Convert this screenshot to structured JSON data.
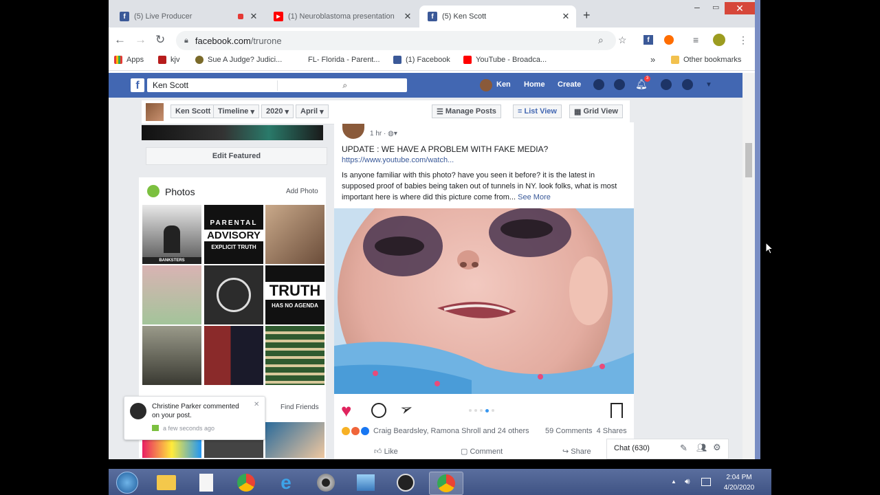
{
  "browser": {
    "tabs": [
      {
        "title": "(5) Live Producer",
        "favicon": "facebook-icon"
      },
      {
        "title": "(1) Neuroblastoma presentation",
        "favicon": "youtube-icon"
      },
      {
        "title": "(5) Ken Scott",
        "favicon": "facebook-icon",
        "active": true
      }
    ],
    "url_host": "facebook.com",
    "url_path": "/trurone",
    "bookmarks": [
      "Apps",
      "kjv",
      "Sue A Judge? Judici...",
      "FL- Florida - Parent...",
      "(1) Facebook",
      "YouTube - Broadca...",
      "Other bookmarks"
    ],
    "more_bookmarks": "»"
  },
  "fb": {
    "search_value": "Ken Scott",
    "user_name": "Ken",
    "nav": [
      "Home",
      "Create"
    ],
    "notif_count": "3"
  },
  "timeline": {
    "crumbs": [
      "Ken Scott",
      "Timeline",
      "2020",
      "April"
    ],
    "manage_posts": "Manage Posts",
    "list_view": "List View",
    "grid_view": "Grid View"
  },
  "left": {
    "edit_featured": "Edit Featured",
    "photos_title": "Photos",
    "add_photo": "Add Photo",
    "photo_texts": {
      "banksters": "BANKSTERS",
      "parental": "PARENTAL",
      "advisory": "ADVISORY",
      "explicit": "EXPLICIT TRUTH",
      "truth": "TRUTH",
      "no_agenda": "HAS NO AGENDA"
    },
    "find_friends": "Find Friends",
    "notification": {
      "name": "Christine Parker",
      "action": "commented",
      "line2": "on your post.",
      "time": "a few seconds ago",
      "close": "✕"
    }
  },
  "post": {
    "time": "1 hr",
    "title": "UPDATE : WE HAVE A PROBLEM WITH FAKE MEDIA?",
    "link": "https://www.youtube.com/watch...",
    "text": "Is anyone familiar with this photo? have you seen it before? it is the latest in supposed proof of babies being taken out of tunnels in NY. look folks, what is most important here is where did this picture come from...",
    "see_more": "See More",
    "reactions_text": "Craig Beardsley, Ramona Shroll and 24 others",
    "comments": "59 Comments",
    "shares": "4 Shares",
    "like": "Like",
    "comment": "Comment",
    "share": "Share"
  },
  "chat": {
    "label": "Chat (630)"
  },
  "taskbar": {
    "time": "2:04 PM",
    "date": "4/20/2020"
  },
  "colors": {
    "fb_blue": "#4267b2",
    "chrome_tab_bg": "#dee1e6",
    "taskbar": "#4a5d8f"
  }
}
